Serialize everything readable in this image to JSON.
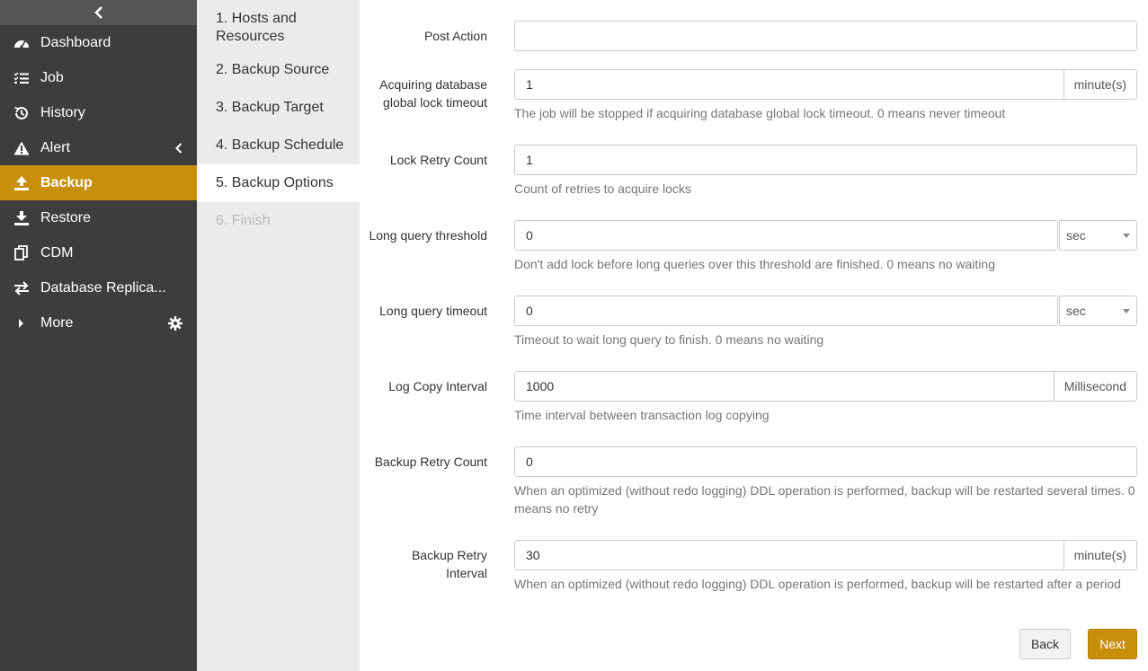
{
  "sidebar": {
    "items": [
      {
        "label": "Dashboard",
        "icon": "dashboard-icon"
      },
      {
        "label": "Job",
        "icon": "list-icon"
      },
      {
        "label": "History",
        "icon": "history-icon"
      },
      {
        "label": "Alert",
        "icon": "warning-icon"
      },
      {
        "label": "Backup",
        "icon": "upload-icon"
      },
      {
        "label": "Restore",
        "icon": "download-icon"
      },
      {
        "label": "CDM",
        "icon": "copy-icon"
      },
      {
        "label": "Database Replica...",
        "icon": "exchange-icon"
      },
      {
        "label": "More",
        "icon": "caret-right-icon"
      }
    ],
    "active": "Backup",
    "accent": "#c8900a"
  },
  "steps": [
    {
      "label": "1. Hosts and Resources"
    },
    {
      "label": "2. Backup Source"
    },
    {
      "label": "3. Backup Target"
    },
    {
      "label": "4. Backup Schedule"
    },
    {
      "label": "5. Backup Options"
    },
    {
      "label": "6. Finish"
    }
  ],
  "form": {
    "post_action": {
      "label": "Post Action",
      "value": ""
    },
    "acquire_lock": {
      "label": "Acquiring database global lock timeout",
      "value": "1",
      "unit": "minute(s)",
      "help": "The job will be stopped if acquiring database global lock timeout. 0 means never timeout"
    },
    "lock_retry": {
      "label": "Lock Retry Count",
      "value": "1",
      "help": "Count of retries to acquire locks"
    },
    "long_query_threshold": {
      "label": "Long query threshold",
      "value": "0",
      "unit": "sec",
      "help": "Don't add lock before long queries over this threshold are finished. 0 means no waiting"
    },
    "long_query_timeout": {
      "label": "Long query timeout",
      "value": "0",
      "unit": "sec",
      "help": "Timeout to wait long query to finish. 0 means no waiting"
    },
    "log_copy_interval": {
      "label": "Log Copy Interval",
      "value": "1000",
      "unit": "Millisecond",
      "help": "Time interval between transaction log copying"
    },
    "backup_retry_count": {
      "label": "Backup Retry Count",
      "value": "0",
      "help": "When an optimized (without redo logging) DDL operation is performed, backup will be restarted several times. 0 means no retry"
    },
    "backup_retry_interval": {
      "label": "Backup Retry Interval",
      "value": "30",
      "unit": "minute(s)",
      "help": "When an optimized (without redo logging) DDL operation is performed, backup will be restarted after a period"
    }
  },
  "buttons": {
    "back": "Back",
    "next": "Next"
  }
}
